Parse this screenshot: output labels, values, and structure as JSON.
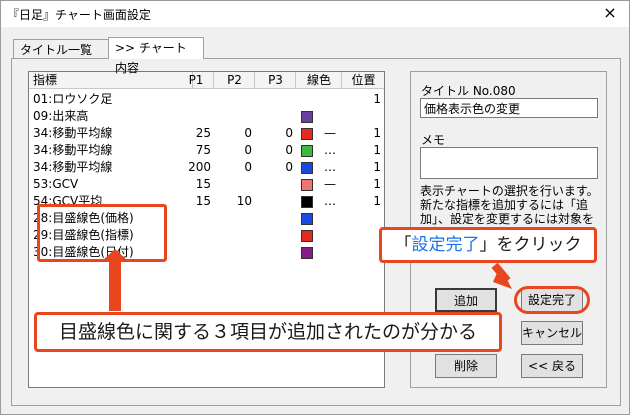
{
  "window": {
    "title": "『日足』チャート画面設定",
    "close_glyph": "×"
  },
  "tabs": [
    {
      "label": "タイトル一覧"
    },
    {
      "label": ">> チャート内容"
    }
  ],
  "list": {
    "headers": {
      "indicator": "指標",
      "p1": "P1",
      "p2": "P2",
      "p3": "P3",
      "line_color": "線色",
      "position": "位置"
    },
    "rows": [
      {
        "indicator": "01:ロウソク足",
        "p1": "",
        "p2": "",
        "p3": "",
        "color": "",
        "style": "",
        "position": "1"
      },
      {
        "indicator": "09:出来高",
        "p1": "",
        "p2": "",
        "p3": "",
        "color": "#6a3da0",
        "style": "",
        "position": ""
      },
      {
        "indicator": "34:移動平均線",
        "p1": "25",
        "p2": "0",
        "p3": "0",
        "color": "#e52b1e",
        "style": "—",
        "position": "1"
      },
      {
        "indicator": "34:移動平均線",
        "p1": "75",
        "p2": "0",
        "p3": "0",
        "color": "#3dba3d",
        "style": "…",
        "position": "1"
      },
      {
        "indicator": "34:移動平均線",
        "p1": "200",
        "p2": "0",
        "p3": "0",
        "color": "#1a4be0",
        "style": "…",
        "position": "1"
      },
      {
        "indicator": "53:GCV",
        "p1": "15",
        "p2": "",
        "p3": "",
        "color": "#f07373",
        "style": "—",
        "position": "1"
      },
      {
        "indicator": "54:GCV平均",
        "p1": "15",
        "p2": "10",
        "p3": "",
        "color": "#000000",
        "style": "…",
        "position": "1"
      },
      {
        "indicator": "28:目盛線色(価格)",
        "p1": "",
        "p2": "",
        "p3": "",
        "color": "#1a4be0",
        "style": "",
        "position": ""
      },
      {
        "indicator": "29:目盛線色(指標)",
        "p1": "",
        "p2": "",
        "p3": "",
        "color": "#e52b1e",
        "style": "",
        "position": ""
      },
      {
        "indicator": "30:目盛線色(日付)",
        "p1": "",
        "p2": "",
        "p3": "",
        "color": "#8a1a8a",
        "style": "",
        "position": ""
      }
    ]
  },
  "side": {
    "title_label": "タイトル No.080",
    "title_value": "価格表示色の変更",
    "memo_label": "メモ",
    "memo_value": "",
    "info_text": "表示チャートの選択を行います。新たな指標を追加するには「追加」、設定を変更するには対象を選択してください。"
  },
  "buttons": {
    "add": "追加",
    "done": "設定完了",
    "cancel": "キャンセル",
    "delete": "削除",
    "back": "<< 戻る"
  },
  "annotations": {
    "done_callout": {
      "prefix": "「",
      "highlight": "設定完了",
      "suffix": "」をクリック"
    },
    "items_callout": "目盛線色に関する３項目が追加されたのが分かる",
    "accent_color": "#e8461e",
    "highlight_color": "#1a73e8"
  }
}
